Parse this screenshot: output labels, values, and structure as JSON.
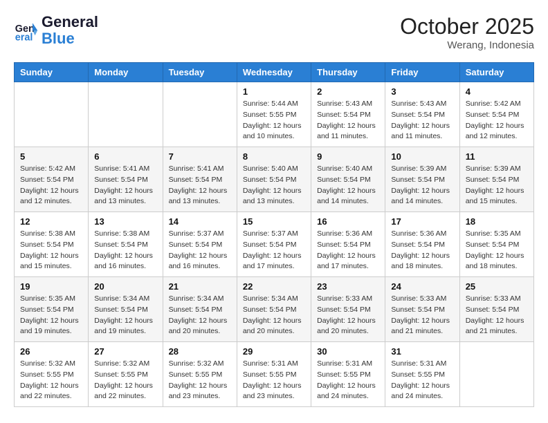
{
  "logo": {
    "line1": "General",
    "line2": "Blue"
  },
  "calendar": {
    "title": "October 2025",
    "location": "Werang, Indonesia",
    "weekdays": [
      "Sunday",
      "Monday",
      "Tuesday",
      "Wednesday",
      "Thursday",
      "Friday",
      "Saturday"
    ],
    "weeks": [
      [
        {
          "day": "",
          "sunrise": "",
          "sunset": "",
          "daylight": ""
        },
        {
          "day": "",
          "sunrise": "",
          "sunset": "",
          "daylight": ""
        },
        {
          "day": "",
          "sunrise": "",
          "sunset": "",
          "daylight": ""
        },
        {
          "day": "1",
          "sunrise": "Sunrise: 5:44 AM",
          "sunset": "Sunset: 5:55 PM",
          "daylight": "Daylight: 12 hours and 10 minutes."
        },
        {
          "day": "2",
          "sunrise": "Sunrise: 5:43 AM",
          "sunset": "Sunset: 5:54 PM",
          "daylight": "Daylight: 12 hours and 11 minutes."
        },
        {
          "day": "3",
          "sunrise": "Sunrise: 5:43 AM",
          "sunset": "Sunset: 5:54 PM",
          "daylight": "Daylight: 12 hours and 11 minutes."
        },
        {
          "day": "4",
          "sunrise": "Sunrise: 5:42 AM",
          "sunset": "Sunset: 5:54 PM",
          "daylight": "Daylight: 12 hours and 12 minutes."
        }
      ],
      [
        {
          "day": "5",
          "sunrise": "Sunrise: 5:42 AM",
          "sunset": "Sunset: 5:54 PM",
          "daylight": "Daylight: 12 hours and 12 minutes."
        },
        {
          "day": "6",
          "sunrise": "Sunrise: 5:41 AM",
          "sunset": "Sunset: 5:54 PM",
          "daylight": "Daylight: 12 hours and 13 minutes."
        },
        {
          "day": "7",
          "sunrise": "Sunrise: 5:41 AM",
          "sunset": "Sunset: 5:54 PM",
          "daylight": "Daylight: 12 hours and 13 minutes."
        },
        {
          "day": "8",
          "sunrise": "Sunrise: 5:40 AM",
          "sunset": "Sunset: 5:54 PM",
          "daylight": "Daylight: 12 hours and 13 minutes."
        },
        {
          "day": "9",
          "sunrise": "Sunrise: 5:40 AM",
          "sunset": "Sunset: 5:54 PM",
          "daylight": "Daylight: 12 hours and 14 minutes."
        },
        {
          "day": "10",
          "sunrise": "Sunrise: 5:39 AM",
          "sunset": "Sunset: 5:54 PM",
          "daylight": "Daylight: 12 hours and 14 minutes."
        },
        {
          "day": "11",
          "sunrise": "Sunrise: 5:39 AM",
          "sunset": "Sunset: 5:54 PM",
          "daylight": "Daylight: 12 hours and 15 minutes."
        }
      ],
      [
        {
          "day": "12",
          "sunrise": "Sunrise: 5:38 AM",
          "sunset": "Sunset: 5:54 PM",
          "daylight": "Daylight: 12 hours and 15 minutes."
        },
        {
          "day": "13",
          "sunrise": "Sunrise: 5:38 AM",
          "sunset": "Sunset: 5:54 PM",
          "daylight": "Daylight: 12 hours and 16 minutes."
        },
        {
          "day": "14",
          "sunrise": "Sunrise: 5:37 AM",
          "sunset": "Sunset: 5:54 PM",
          "daylight": "Daylight: 12 hours and 16 minutes."
        },
        {
          "day": "15",
          "sunrise": "Sunrise: 5:37 AM",
          "sunset": "Sunset: 5:54 PM",
          "daylight": "Daylight: 12 hours and 17 minutes."
        },
        {
          "day": "16",
          "sunrise": "Sunrise: 5:36 AM",
          "sunset": "Sunset: 5:54 PM",
          "daylight": "Daylight: 12 hours and 17 minutes."
        },
        {
          "day": "17",
          "sunrise": "Sunrise: 5:36 AM",
          "sunset": "Sunset: 5:54 PM",
          "daylight": "Daylight: 12 hours and 18 minutes."
        },
        {
          "day": "18",
          "sunrise": "Sunrise: 5:35 AM",
          "sunset": "Sunset: 5:54 PM",
          "daylight": "Daylight: 12 hours and 18 minutes."
        }
      ],
      [
        {
          "day": "19",
          "sunrise": "Sunrise: 5:35 AM",
          "sunset": "Sunset: 5:54 PM",
          "daylight": "Daylight: 12 hours and 19 minutes."
        },
        {
          "day": "20",
          "sunrise": "Sunrise: 5:34 AM",
          "sunset": "Sunset: 5:54 PM",
          "daylight": "Daylight: 12 hours and 19 minutes."
        },
        {
          "day": "21",
          "sunrise": "Sunrise: 5:34 AM",
          "sunset": "Sunset: 5:54 PM",
          "daylight": "Daylight: 12 hours and 20 minutes."
        },
        {
          "day": "22",
          "sunrise": "Sunrise: 5:34 AM",
          "sunset": "Sunset: 5:54 PM",
          "daylight": "Daylight: 12 hours and 20 minutes."
        },
        {
          "day": "23",
          "sunrise": "Sunrise: 5:33 AM",
          "sunset": "Sunset: 5:54 PM",
          "daylight": "Daylight: 12 hours and 20 minutes."
        },
        {
          "day": "24",
          "sunrise": "Sunrise: 5:33 AM",
          "sunset": "Sunset: 5:54 PM",
          "daylight": "Daylight: 12 hours and 21 minutes."
        },
        {
          "day": "25",
          "sunrise": "Sunrise: 5:33 AM",
          "sunset": "Sunset: 5:54 PM",
          "daylight": "Daylight: 12 hours and 21 minutes."
        }
      ],
      [
        {
          "day": "26",
          "sunrise": "Sunrise: 5:32 AM",
          "sunset": "Sunset: 5:55 PM",
          "daylight": "Daylight: 12 hours and 22 minutes."
        },
        {
          "day": "27",
          "sunrise": "Sunrise: 5:32 AM",
          "sunset": "Sunset: 5:55 PM",
          "daylight": "Daylight: 12 hours and 22 minutes."
        },
        {
          "day": "28",
          "sunrise": "Sunrise: 5:32 AM",
          "sunset": "Sunset: 5:55 PM",
          "daylight": "Daylight: 12 hours and 23 minutes."
        },
        {
          "day": "29",
          "sunrise": "Sunrise: 5:31 AM",
          "sunset": "Sunset: 5:55 PM",
          "daylight": "Daylight: 12 hours and 23 minutes."
        },
        {
          "day": "30",
          "sunrise": "Sunrise: 5:31 AM",
          "sunset": "Sunset: 5:55 PM",
          "daylight": "Daylight: 12 hours and 24 minutes."
        },
        {
          "day": "31",
          "sunrise": "Sunrise: 5:31 AM",
          "sunset": "Sunset: 5:55 PM",
          "daylight": "Daylight: 12 hours and 24 minutes."
        },
        {
          "day": "",
          "sunrise": "",
          "sunset": "",
          "daylight": ""
        }
      ]
    ]
  }
}
